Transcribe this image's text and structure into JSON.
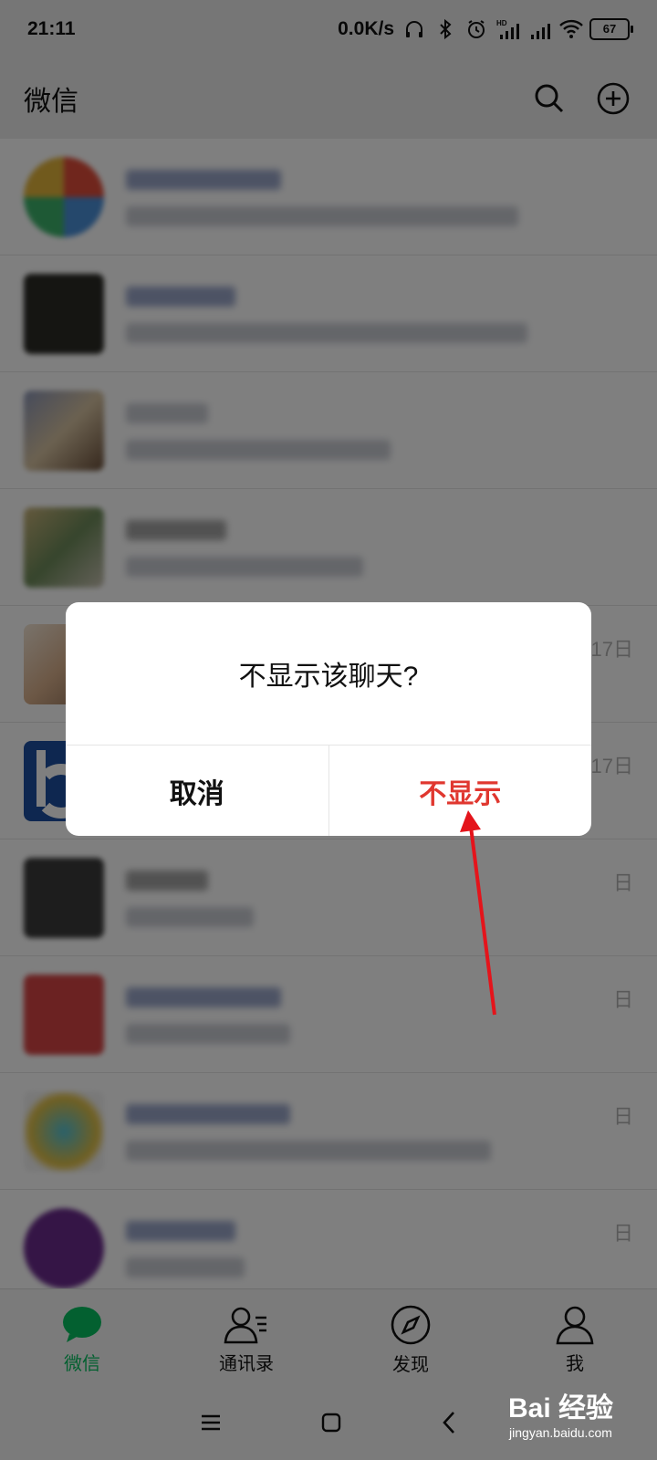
{
  "status_bar": {
    "time": "21:11",
    "network_speed": "0.0K/s",
    "signal_label": "HD",
    "battery": "67"
  },
  "header": {
    "title": "微信"
  },
  "chats": [
    {
      "time": ""
    },
    {
      "time": ""
    },
    {
      "time": ""
    },
    {
      "time": ""
    },
    {
      "time": "17日"
    },
    {
      "time": "17日"
    },
    {
      "time": "日"
    },
    {
      "time": "日"
    },
    {
      "time": "日"
    },
    {
      "time": "日"
    }
  ],
  "tabs": [
    {
      "label": "微信",
      "icon": "chat-bubble-icon",
      "active": true
    },
    {
      "label": "通讯录",
      "icon": "contacts-icon",
      "active": false
    },
    {
      "label": "发现",
      "icon": "compass-icon",
      "active": false
    },
    {
      "label": "我",
      "icon": "person-icon",
      "active": false
    }
  ],
  "dialog": {
    "question": "不显示该聊天?",
    "cancel": "取消",
    "confirm": "不显示"
  },
  "watermark": {
    "main": "Bai 经验",
    "sub": "jingyan.baidu.com"
  },
  "colors": {
    "accent": "#07c160",
    "danger": "#e0372f",
    "mask": "rgba(0,0,0,0.5)"
  }
}
